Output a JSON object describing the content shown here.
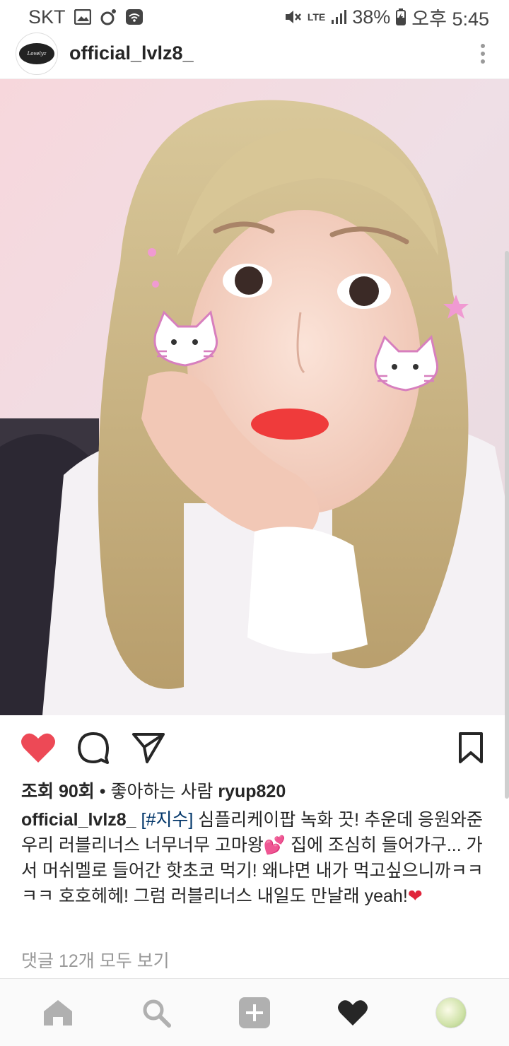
{
  "status_bar": {
    "carrier": "SKT",
    "network": "LTE",
    "battery": "38%",
    "time": "오후 5:45"
  },
  "post": {
    "username": "official_lvlz8_",
    "avatar_text": "Lovelyz",
    "views_label": "조회 90회",
    "liked_by_prefix": "좋아하는 사람",
    "liked_by_user": "ryup820",
    "separator": "•",
    "caption_user": "official_lvlz8_",
    "caption_hashtag": "[#지수]",
    "caption_text_1": "심플리케이팝 녹화 끗! 추운데 응원와준 우리 러블리너스 너무너무 고마왕",
    "caption_emoji_1": "💕",
    "caption_text_2": "집에 조심히 들어가구... 가서 머쉬멜로 들어간 핫초코 먹기! 왜냐면 내가 먹고싶으니까ㅋㅋㅋㅋ 호호헤헤! 그럼 러블리너스 내일도 만날래 yeah!",
    "caption_emoji_2": "❤",
    "comments_link": "댓글 12개 모두 보기"
  },
  "icons": {
    "like": "heart-filled-icon",
    "comment": "comment-icon",
    "share": "send-icon",
    "save": "bookmark-icon",
    "nav": [
      "home-icon",
      "search-icon",
      "add-post-icon",
      "activity-heart-icon",
      "profile-avatar"
    ]
  },
  "colors": {
    "like_red": "#ED4956",
    "hashtag": "#003569",
    "muted": "#999999",
    "text": "#262626"
  }
}
